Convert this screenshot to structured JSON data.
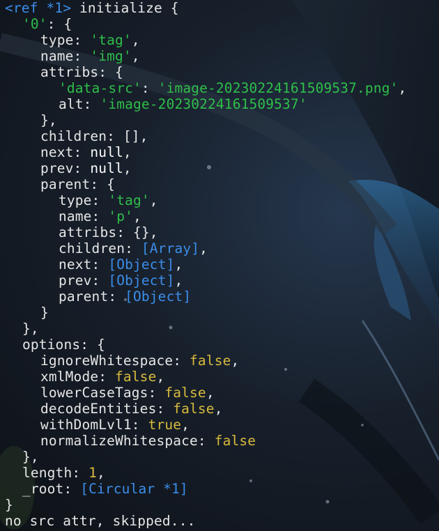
{
  "terminal": {
    "lines": [
      {
        "indent": 0,
        "parts": [
          {
            "t": "<ref *1>",
            "c": "ref"
          },
          {
            "t": " initialize {",
            "c": "plain"
          }
        ]
      },
      {
        "indent": 1,
        "parts": [
          {
            "t": "'0'",
            "c": "str"
          },
          {
            "t": ": {",
            "c": "plain"
          }
        ]
      },
      {
        "indent": 2,
        "parts": [
          {
            "t": "type: ",
            "c": "plain"
          },
          {
            "t": "'tag'",
            "c": "str"
          },
          {
            "t": ",",
            "c": "plain"
          }
        ]
      },
      {
        "indent": 2,
        "parts": [
          {
            "t": "name: ",
            "c": "plain"
          },
          {
            "t": "'img'",
            "c": "str"
          },
          {
            "t": ",",
            "c": "plain"
          }
        ]
      },
      {
        "indent": 2,
        "parts": [
          {
            "t": "attribs: {",
            "c": "plain"
          }
        ]
      },
      {
        "indent": 3,
        "parts": [
          {
            "t": "'data-src'",
            "c": "str"
          },
          {
            "t": ": ",
            "c": "plain"
          },
          {
            "t": "'image-20230224161509537.png'",
            "c": "str"
          },
          {
            "t": ",",
            "c": "plain"
          }
        ]
      },
      {
        "indent": 3,
        "parts": [
          {
            "t": "alt: ",
            "c": "plain"
          },
          {
            "t": "'image-20230224161509537'",
            "c": "str"
          }
        ]
      },
      {
        "indent": 2,
        "parts": [
          {
            "t": "},",
            "c": "plain"
          }
        ]
      },
      {
        "indent": 2,
        "parts": [
          {
            "t": "children: [],",
            "c": "plain"
          }
        ]
      },
      {
        "indent": 2,
        "parts": [
          {
            "t": "next: ",
            "c": "plain"
          },
          {
            "t": "null",
            "c": "kw"
          },
          {
            "t": ",",
            "c": "plain"
          }
        ]
      },
      {
        "indent": 2,
        "parts": [
          {
            "t": "prev: ",
            "c": "plain"
          },
          {
            "t": "null",
            "c": "kw"
          },
          {
            "t": ",",
            "c": "plain"
          }
        ]
      },
      {
        "indent": 2,
        "parts": [
          {
            "t": "parent: {",
            "c": "plain"
          }
        ]
      },
      {
        "indent": 3,
        "parts": [
          {
            "t": "type: ",
            "c": "plain"
          },
          {
            "t": "'tag'",
            "c": "str"
          },
          {
            "t": ",",
            "c": "plain"
          }
        ]
      },
      {
        "indent": 3,
        "parts": [
          {
            "t": "name: ",
            "c": "plain"
          },
          {
            "t": "'p'",
            "c": "str"
          },
          {
            "t": ",",
            "c": "plain"
          }
        ]
      },
      {
        "indent": 3,
        "parts": [
          {
            "t": "attribs: {},",
            "c": "plain"
          }
        ]
      },
      {
        "indent": 3,
        "parts": [
          {
            "t": "children: ",
            "c": "plain"
          },
          {
            "t": "[Array]",
            "c": "obj"
          },
          {
            "t": ",",
            "c": "plain"
          }
        ]
      },
      {
        "indent": 3,
        "parts": [
          {
            "t": "next: ",
            "c": "plain"
          },
          {
            "t": "[Object]",
            "c": "obj"
          },
          {
            "t": ",",
            "c": "plain"
          }
        ]
      },
      {
        "indent": 3,
        "parts": [
          {
            "t": "prev: ",
            "c": "plain"
          },
          {
            "t": "[Object]",
            "c": "obj"
          },
          {
            "t": ",",
            "c": "plain"
          }
        ]
      },
      {
        "indent": 3,
        "parts": [
          {
            "t": "parent: ",
            "c": "plain"
          },
          {
            "t": "[Object]",
            "c": "obj"
          }
        ]
      },
      {
        "indent": 2,
        "parts": [
          {
            "t": "}",
            "c": "plain"
          }
        ]
      },
      {
        "indent": 1,
        "parts": [
          {
            "t": "},",
            "c": "plain"
          }
        ]
      },
      {
        "indent": 1,
        "parts": [
          {
            "t": "options: {",
            "c": "plain"
          }
        ]
      },
      {
        "indent": 2,
        "parts": [
          {
            "t": "ignoreWhitespace: ",
            "c": "plain"
          },
          {
            "t": "false",
            "c": "bool"
          },
          {
            "t": ",",
            "c": "plain"
          }
        ]
      },
      {
        "indent": 2,
        "parts": [
          {
            "t": "xmlMode: ",
            "c": "plain"
          },
          {
            "t": "false",
            "c": "bool"
          },
          {
            "t": ",",
            "c": "plain"
          }
        ]
      },
      {
        "indent": 2,
        "parts": [
          {
            "t": "lowerCaseTags: ",
            "c": "plain"
          },
          {
            "t": "false",
            "c": "bool"
          },
          {
            "t": ",",
            "c": "plain"
          }
        ]
      },
      {
        "indent": 2,
        "parts": [
          {
            "t": "decodeEntities: ",
            "c": "plain"
          },
          {
            "t": "false",
            "c": "bool"
          },
          {
            "t": ",",
            "c": "plain"
          }
        ]
      },
      {
        "indent": 2,
        "parts": [
          {
            "t": "withDomLvl1: ",
            "c": "plain"
          },
          {
            "t": "true",
            "c": "bool"
          },
          {
            "t": ",",
            "c": "plain"
          }
        ]
      },
      {
        "indent": 2,
        "parts": [
          {
            "t": "normalizeWhitespace: ",
            "c": "plain"
          },
          {
            "t": "false",
            "c": "bool"
          }
        ]
      },
      {
        "indent": 1,
        "parts": [
          {
            "t": "},",
            "c": "plain"
          }
        ]
      },
      {
        "indent": 1,
        "parts": [
          {
            "t": "length: ",
            "c": "plain"
          },
          {
            "t": "1",
            "c": "num"
          },
          {
            "t": ",",
            "c": "plain"
          }
        ]
      },
      {
        "indent": 1,
        "parts": [
          {
            "t": "_root: ",
            "c": "plain"
          },
          {
            "t": "[Circular *1]",
            "c": "obj"
          }
        ]
      },
      {
        "indent": 0,
        "parts": [
          {
            "t": "}",
            "c": "plain"
          }
        ]
      },
      {
        "indent": 0,
        "parts": [
          {
            "t": "no src attr, skipped...",
            "c": "plain"
          }
        ]
      }
    ]
  },
  "colors": {
    "background": "#121a22",
    "text": "#e6e6e6",
    "string": "#2fbf4a",
    "reference": "#3b8eea",
    "boolean": "#d7ba3c",
    "keyword": "#ffffff"
  }
}
